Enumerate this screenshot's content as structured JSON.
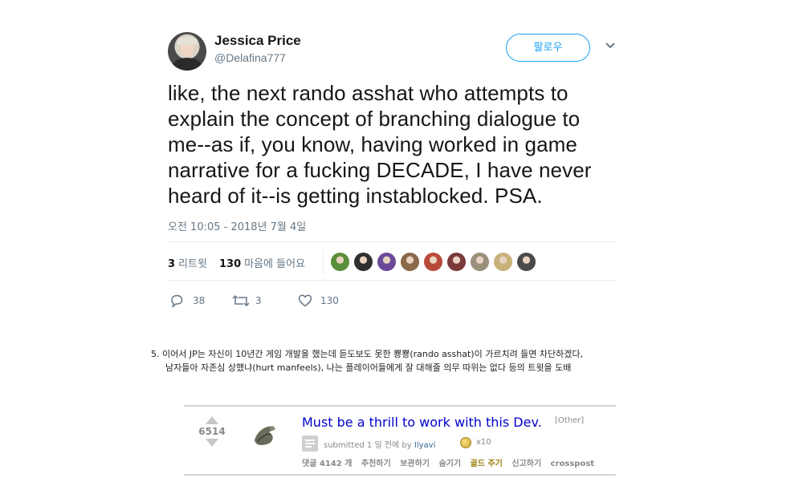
{
  "tweet": {
    "name": "Jessica Price",
    "handle": "@Delafina777",
    "follow_label": "팔로우",
    "text": "like, the next rando asshat who attempts to explain the concept of branching dialogue to me--as if, you know, having worked in game narrative for a fucking DECADE, I have never heard of it--is getting instablocked. PSA.",
    "timestamp": "오전 10:05 - 2018년 7월 4일",
    "retweets_count": "3",
    "retweets_label": "리트윗",
    "likes_count": "130",
    "likes_label": "마음에 들어요",
    "reply_count": "38",
    "retweet_action_count": "3",
    "like_action_count": "130",
    "liker_colors": [
      "#5a8f3c",
      "#2f2f2f",
      "#6b4a9a",
      "#8a6a4a",
      "#b84a3a",
      "#7a3a3a",
      "#9a8f7a",
      "#c9b27a",
      "#4a4a4a"
    ]
  },
  "note": {
    "line1": "5. 이어서 JP는 자신이 10년간 게임 개발을 했는데 듣도보도 못한 뿅뿅(rando asshat)이 가르치려 들면 차단하겠다,",
    "line2": "남자들아 자존심 상했냐(hurt manfeels), 나는 플레이어들에게 잘 대해줄 의무 따위는 없다 등의 트윗을 도배"
  },
  "reddit": {
    "score": "6514",
    "title": "Must be a thrill to work with this Dev.",
    "flair": "[Other]",
    "submitted_prefix": "submitted 1 일 전에 by",
    "user": "Ilyavi",
    "gild_count": "x10",
    "buttons": {
      "comments": "댓글 4142 개",
      "recommend": "추천하기",
      "save": "보관하기",
      "hide": "숨기기",
      "gold": "골드 주기",
      "report": "신고하기",
      "crosspost": "crosspost"
    },
    "colors": {
      "title": "#0000cc",
      "gold": "#9a7d0a",
      "user": "#336699"
    }
  },
  "colors": {
    "twitter_blue": "#1da1f2",
    "muted": "#657786"
  }
}
